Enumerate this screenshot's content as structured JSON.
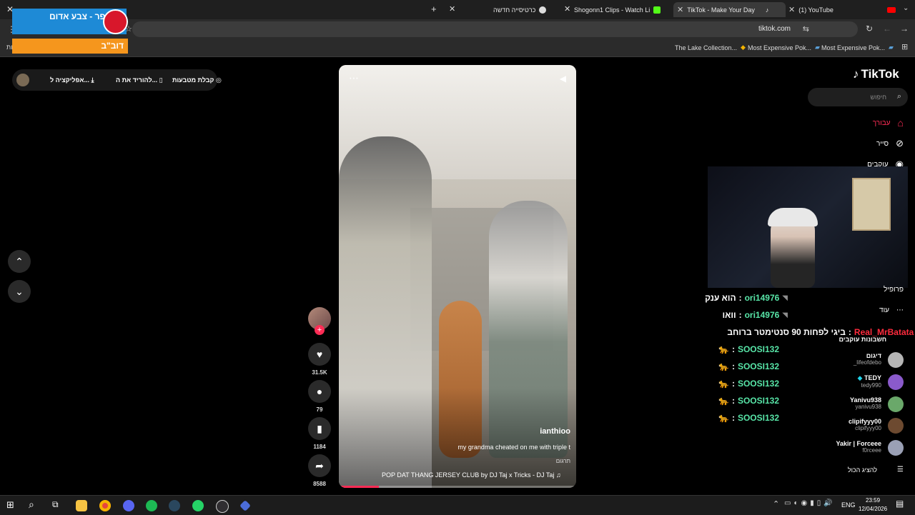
{
  "browser": {
    "tabs": [
      {
        "title": "כרטיסייה חדשה"
      },
      {
        "title": "Shogonn1 Clips - Watch Li"
      },
      {
        "title": "TikTok - Make Your Day"
      },
      {
        "title": "(1) YouTube"
      }
    ],
    "url": "tiktok.com",
    "bookmarks": [
      "The Lake Collection...",
      "Most Expensive Pok...",
      "Most Expensive Pok..."
    ],
    "bookmark_left_fragment": "ות"
  },
  "overlay": {
    "blue_banner": "צופר - צבע אדום",
    "orange_banner": "דוב\"ב"
  },
  "tiktok": {
    "logo": "TikTok",
    "search_placeholder": "חיפוש",
    "top_pill": {
      "coins": "קבלת מטבעות",
      "download": "להוריד את ה...",
      "app": "אפליקציה ל..."
    },
    "nav": {
      "for_you": "עבורך",
      "explore": "סייר",
      "following": "עוקבים",
      "profile": "פרופיל",
      "more": "עוד",
      "followed_accounts": "חשבונות עוקבים",
      "see_all": "להציג הכול"
    },
    "video": {
      "username": "ianthioo",
      "caption": "my grandma cheated on me with triple t",
      "translate": "תרגום",
      "music": "POP DAT THANG JERSEY CLUB by DJ Taj x Tricks - DJ Taj",
      "progress": 0.17
    },
    "actions": {
      "likes": "31.5K",
      "comments": "79",
      "saves": "1184",
      "shares": "8588"
    },
    "following_accounts": [
      {
        "name": "דיגום",
        "handle": "_lifeofdebo"
      },
      {
        "name": "TEDY",
        "handle": "tedy990"
      },
      {
        "name": "Yanivu938",
        "handle": "yanivu938"
      },
      {
        "name": "clipifyyy00",
        "handle": "clipifyyy00"
      },
      {
        "name": "Yakir | Forceee",
        "handle": "f0rceee"
      }
    ]
  },
  "chat": [
    {
      "user": "ori14976",
      "message": "הוא ענק",
      "color": "#58e6a8"
    },
    {
      "user": "ori14976",
      "message": "וואו",
      "color": "#58e6a8"
    },
    {
      "user": "Real_MrBatata",
      "message": "ביגי לפחות 90 סנטימטר ברוחב",
      "color": "#ff2b3d"
    },
    {
      "user": "SOOSI132",
      "message": "🐆",
      "color": "#58e6a8"
    },
    {
      "user": "SOOSI132",
      "message": "🐆",
      "color": "#58e6a8"
    },
    {
      "user": "SOOSI132",
      "message": "🐆",
      "color": "#58e6a8"
    },
    {
      "user": "SOOSI132",
      "message": "🐆",
      "color": "#58e6a8"
    },
    {
      "user": "SOOSI132",
      "message": "🐆",
      "color": "#58e6a8"
    }
  ],
  "taskbar": {
    "lang": "ENG",
    "time": "23:59",
    "date": "12/04/2026"
  },
  "colors": {
    "tiktok_red": "#fe2c55",
    "chat_green": "#58e6a8",
    "chat_red": "#ff2b3d"
  }
}
